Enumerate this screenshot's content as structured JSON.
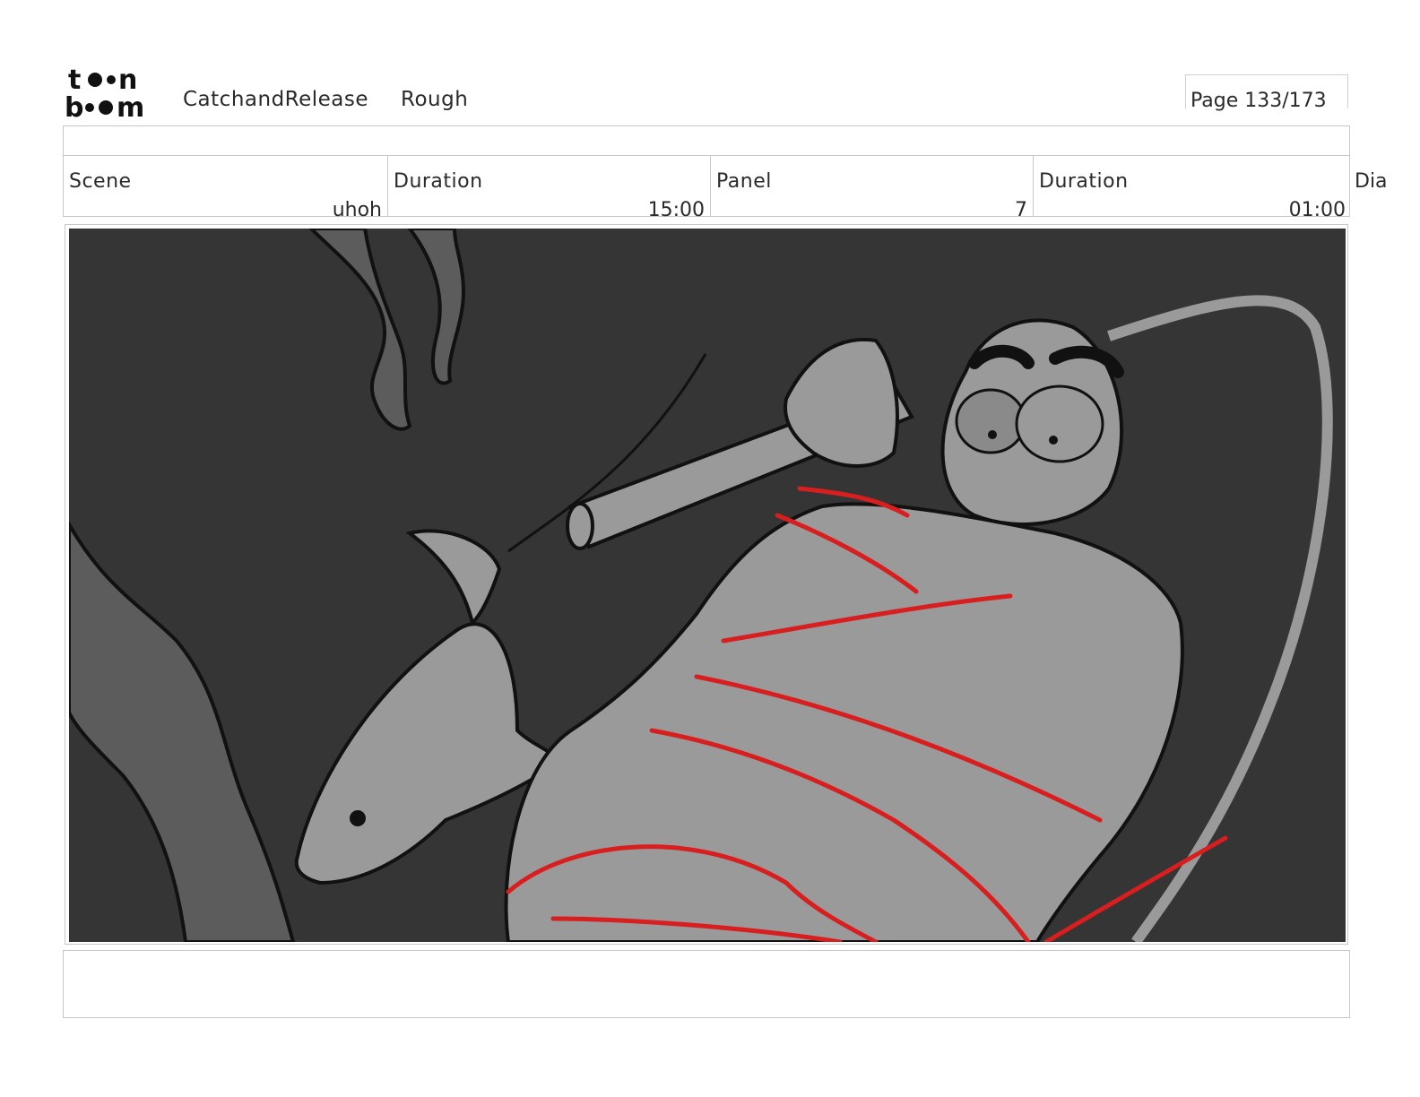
{
  "header": {
    "logo_top": "t●●n",
    "logo_bottom": "b●●m",
    "project_name": "CatchandRelease",
    "stage": "Rough",
    "page_label": "Page 133/173"
  },
  "info": {
    "scene_label": "Scene",
    "scene_value": "uhoh",
    "scene_duration_label": "Duration",
    "scene_duration_value": "15:00",
    "panel_label": "Panel",
    "panel_value": "7",
    "panel_duration_label": "Duration",
    "panel_duration_value": "01:00",
    "dialogue_label": "Dia"
  },
  "panel": {
    "background_color": "#353535",
    "figure_color": "#9a9a9a",
    "kelp_color": "#5c5c5c",
    "line_color": "#111111",
    "red_line_color": "#d81e1e"
  },
  "notes": {
    "text": ""
  }
}
